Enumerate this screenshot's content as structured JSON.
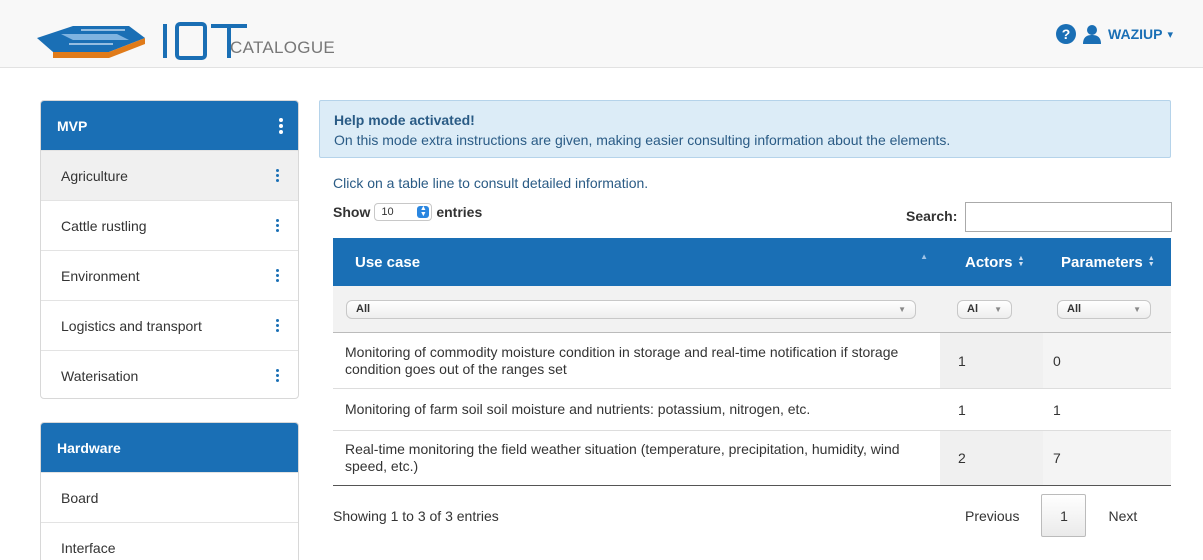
{
  "header": {
    "logo_text": "CATALOGUE",
    "logo_lettering": "IoT",
    "user_name": "WAZIUP",
    "help_glyph": "?",
    "icons": [
      "logo-icon",
      "help-icon",
      "user-icon",
      "caret-down-icon"
    ]
  },
  "colors": {
    "primary": "#1a6fb5",
    "help_bg": "#dcecf7",
    "help_text": "#2a5b85"
  },
  "sidebar": {
    "mvp": {
      "title": "MVP",
      "items": [
        {
          "label": "Agriculture"
        },
        {
          "label": "Cattle rustling"
        },
        {
          "label": "Environment"
        },
        {
          "label": "Logistics and transport"
        },
        {
          "label": "Waterisation"
        }
      ]
    },
    "hardware": {
      "title": "Hardware",
      "items": [
        {
          "label": "Board"
        },
        {
          "label": "Interface"
        }
      ]
    }
  },
  "help": {
    "title": "Help mode activated!",
    "text": "On this mode extra instructions are given, making easier consulting information about the elements."
  },
  "instructions": "Click on a table line to consult detailed information.",
  "length": {
    "show_label": "Show",
    "value": "10",
    "entries_label": "entries"
  },
  "search": {
    "label": "Search:",
    "value": ""
  },
  "table": {
    "columns": [
      "Use case",
      "Actors",
      "Parameters"
    ],
    "filters": [
      "All",
      "Al",
      "All"
    ],
    "rows": [
      {
        "use_case": "Monitoring of commodity moisture condition in storage and real-time notification if storage condition goes out of the ranges set",
        "actors": "1",
        "parameters": "0"
      },
      {
        "use_case": "Monitoring of farm soil soil moisture and nutrients: potassium, nitrogen, etc.",
        "actors": "1",
        "parameters": "1"
      },
      {
        "use_case": "Real-time monitoring the field weather situation (temperature, precipitation, humidity, wind speed, etc.)",
        "actors": "2",
        "parameters": "7"
      }
    ]
  },
  "footer": {
    "info": "Showing 1 to 3 of 3 entries",
    "previous": "Previous",
    "current_page": "1",
    "next": "Next"
  }
}
